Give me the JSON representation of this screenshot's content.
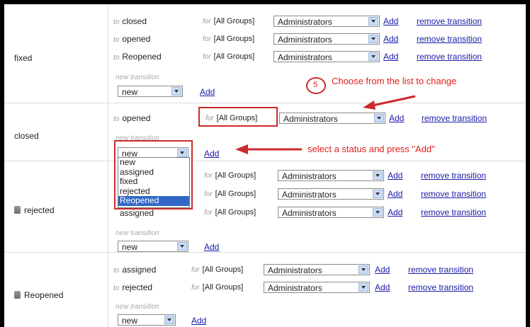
{
  "common": {
    "to_prefix": "to",
    "for_prefix": "for",
    "group": "[All Groups]",
    "role": "Administrators",
    "add": "Add",
    "remove": "remove transition",
    "new_transition": "new transition",
    "new_default": "new"
  },
  "rows": {
    "fixed": {
      "name": "fixed",
      "transitions": [
        "closed",
        "opened",
        "Reopened"
      ]
    },
    "closed": {
      "name": "closed",
      "transitions": [
        "opened"
      ]
    },
    "rejected": {
      "name": "rejected",
      "transitions": [
        "",
        "",
        "assigned"
      ]
    },
    "reopened": {
      "name": "Reopened",
      "transitions": [
        "assigned",
        "rejected"
      ]
    }
  },
  "annotations": {
    "step_number": "5",
    "choose_text": "Choose from the list to change",
    "select_text": "select a status and press \"Add\""
  },
  "dropdown_options": [
    "new",
    "assigned",
    "fixed",
    "rejected",
    "Reopened"
  ],
  "colors": {
    "annotation_red": "#cc2a2a",
    "link_blue": "#1a1aa6",
    "highlight": "#3168c6"
  }
}
